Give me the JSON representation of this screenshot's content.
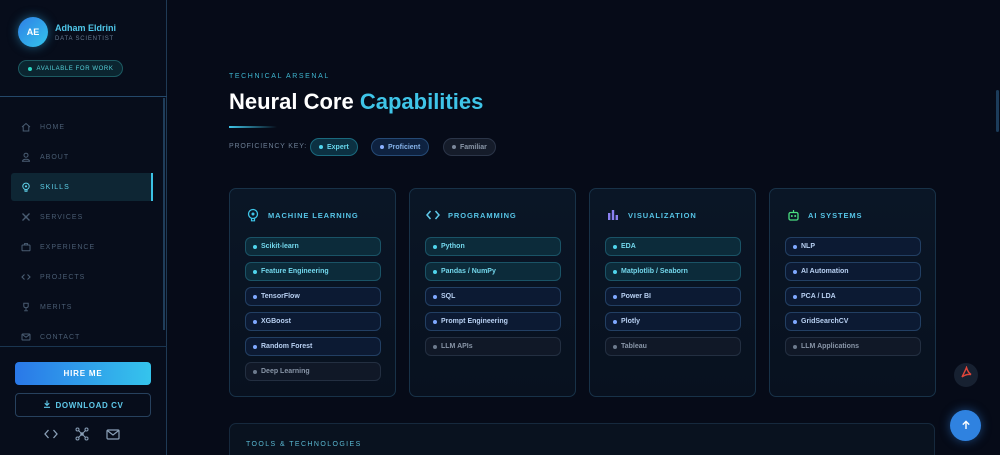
{
  "profile": {
    "initials": "AE",
    "name": "Adham Eldrini",
    "role": "DATA SCIENTIST",
    "status": "AVAILABLE FOR WORK"
  },
  "nav": [
    {
      "label": "HOME",
      "icon": "home-icon"
    },
    {
      "label": "ABOUT",
      "icon": "user-icon"
    },
    {
      "label": "SKILLS",
      "icon": "brain-icon",
      "active": true
    },
    {
      "label": "SERVICES",
      "icon": "services-icon"
    },
    {
      "label": "EXPERIENCE",
      "icon": "briefcase-icon"
    },
    {
      "label": "PROJECTS",
      "icon": "code-icon"
    },
    {
      "label": "MERITS",
      "icon": "trophy-icon"
    },
    {
      "label": "CONTACT",
      "icon": "mail-icon"
    }
  ],
  "sidebar_actions": {
    "hire": "HIRE ME",
    "download": "DOWNLOAD CV"
  },
  "socials": [
    "code-icon",
    "network-icon",
    "mail-icon"
  ],
  "section": {
    "eyebrow": "TECHNICAL ARSENAL",
    "title_main": "Neural Core",
    "title_accent": "Capabilities",
    "key_label": "PROFICIENCY KEY:",
    "levels": {
      "expert": "Expert",
      "proficient": "Proficient",
      "familiar": "Familiar"
    }
  },
  "colors": {
    "accent": "#3fc5e8",
    "expert": "#4fd4ec",
    "proficient": "#7fa8ff",
    "familiar": "#6c7a8d",
    "ai": "#4ade80"
  },
  "cards": [
    {
      "title": "MACHINE LEARNING",
      "icon": "brain-icon",
      "skills": [
        {
          "name": "Scikit-learn",
          "level": "expert"
        },
        {
          "name": "Feature Engineering",
          "level": "expert"
        },
        {
          "name": "TensorFlow",
          "level": "proficient"
        },
        {
          "name": "XGBoost",
          "level": "proficient"
        },
        {
          "name": "Random Forest",
          "level": "proficient"
        },
        {
          "name": "Deep Learning",
          "level": "familiar"
        }
      ]
    },
    {
      "title": "PROGRAMMING",
      "icon": "code-icon",
      "skills": [
        {
          "name": "Python",
          "level": "expert"
        },
        {
          "name": "Pandas / NumPy",
          "level": "expert"
        },
        {
          "name": "SQL",
          "level": "proficient"
        },
        {
          "name": "Prompt Engineering",
          "level": "proficient"
        },
        {
          "name": "LLM APIs",
          "level": "familiar"
        }
      ]
    },
    {
      "title": "VISUALIZATION",
      "icon": "bar-chart-icon",
      "skills": [
        {
          "name": "EDA",
          "level": "expert"
        },
        {
          "name": "Matplotlib / Seaborn",
          "level": "expert"
        },
        {
          "name": "Power BI",
          "level": "proficient"
        },
        {
          "name": "Plotly",
          "level": "proficient"
        },
        {
          "name": "Tableau",
          "level": "familiar"
        }
      ]
    },
    {
      "title": "AI SYSTEMS",
      "icon": "robot-icon",
      "skills": [
        {
          "name": "NLP",
          "level": "proficient"
        },
        {
          "name": "AI Automation",
          "level": "proficient"
        },
        {
          "name": "PCA / LDA",
          "level": "proficient"
        },
        {
          "name": "GridSearchCV",
          "level": "proficient"
        },
        {
          "name": "LLM Applications",
          "level": "familiar"
        }
      ]
    }
  ],
  "tools": {
    "label": "TOOLS & TECHNOLOGIES"
  }
}
